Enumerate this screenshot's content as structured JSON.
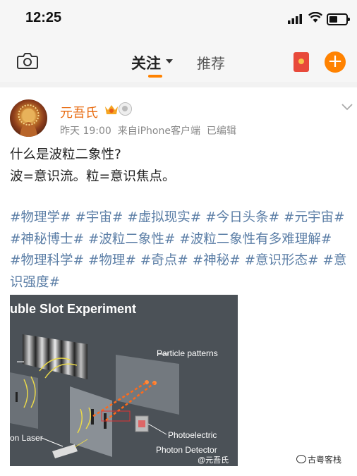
{
  "status_bar": {
    "time": "12:25"
  },
  "nav": {
    "tab_follow": "关注",
    "tab_recommend": "推荐"
  },
  "post": {
    "username": "元吾氏",
    "meta": "昨天 19:00  来自iPhone客户端  已编辑",
    "line1": "什么是波粒二象性?",
    "line2": "波=意识流。粒=意识焦点。",
    "tag_lines": [
      "#物理学# #宇宙# #虚拟现实# #今日头条# #元宇宙#",
      "#神秘博士# #波粒二象性# #波粒二象性有多难理解#",
      "#物理科学# #物理# #奇点# #神秘# #意识形态# #意",
      "识强度#"
    ]
  },
  "image": {
    "title": "uble Slot Experiment",
    "label_particle": "Particle patterns",
    "label_laser": "on Laser",
    "label_photoelectric": "Photoelectric",
    "label_detector": "Photon Detector",
    "watermark": "@元吾氏"
  },
  "page_watermark": "古粤客栈",
  "colors": {
    "accent": "#ff8200",
    "username": "#e86b10",
    "tag": "#5b7ea6"
  },
  "icons": [
    "signal-icon",
    "wifi-icon",
    "battery-icon",
    "camera-icon",
    "red-packet-icon",
    "plus-icon",
    "vip-crown-icon",
    "medal-icon",
    "chevron-down-icon"
  ]
}
